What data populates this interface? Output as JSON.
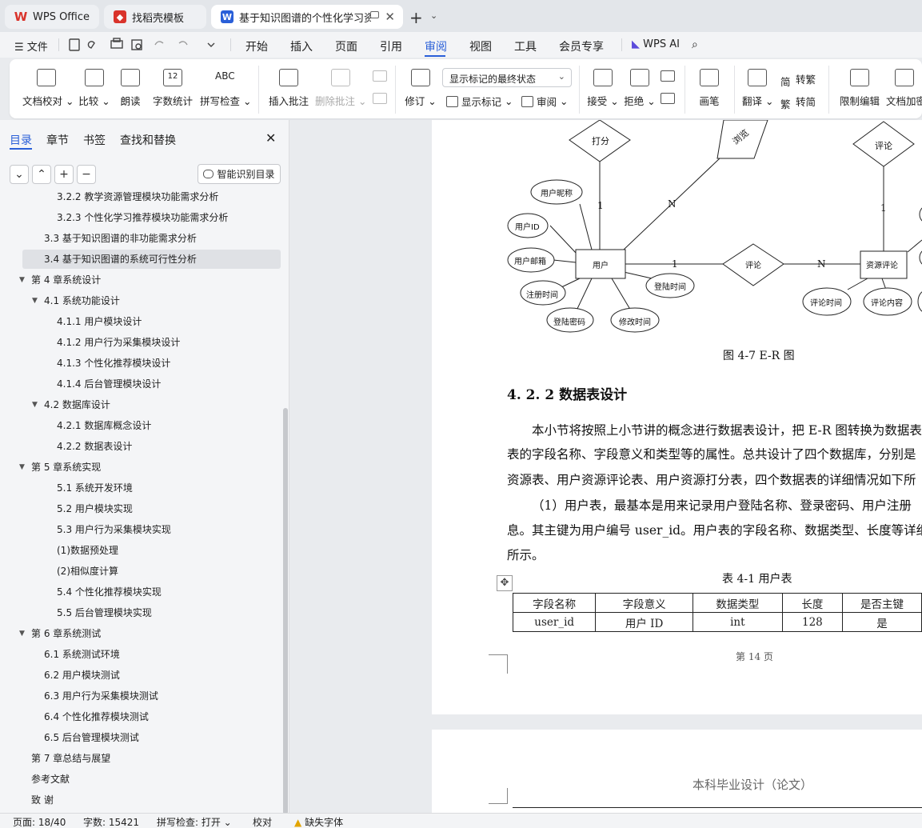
{
  "tabs": [
    {
      "label": "WPS Office"
    },
    {
      "label": "找稻壳模板"
    },
    {
      "label": "基于知识图谱的个性化学习资源推荐系统"
    }
  ],
  "menu": {
    "file": "文件",
    "items": [
      "开始",
      "插入",
      "页面",
      "引用",
      "审阅",
      "视图",
      "工具",
      "会员专享"
    ],
    "active": "审阅",
    "wps_ai": "WPS AI"
  },
  "ribbon": {
    "proof": "文档校对",
    "compare": "比较",
    "read": "朗读",
    "wordcount": "字数统计",
    "spell": "拼写检查",
    "spell_icon_text": "ABC",
    "wordcount_icon_text": "12",
    "insert_comment": "插入批注",
    "delete_comment": "删除批注",
    "revise": "修订",
    "mark_state": "显示标记的最终状态",
    "show_marks": "显示标记",
    "review": "审阅",
    "accept": "接受",
    "reject": "拒绝",
    "pen": "画笔",
    "translate": "翻译",
    "to_trad": "转繁",
    "to_simp": "转简",
    "restrict": "限制编辑",
    "encrypt": "文档加密"
  },
  "nav": {
    "tabs": [
      "目录",
      "章节",
      "书签",
      "查找和替换"
    ],
    "smart_toc": "智能识别目录",
    "toc": [
      {
        "text": "3.2.2 教学资源管理模块功能需求分析",
        "level": 3,
        "arrow": ""
      },
      {
        "text": "3.2.3 个性化学习推荐模块功能需求分析",
        "level": 3,
        "arrow": ""
      },
      {
        "text": "3.3  基于知识图谱的非功能需求分析",
        "level": 2,
        "arrow": ""
      },
      {
        "text": "3.4  基于知识图谱的系统可行性分析",
        "level": 2,
        "arrow": "",
        "selected": true
      },
      {
        "text": "第 4 章系统设计",
        "level": 1,
        "arrow": "▼"
      },
      {
        "text": "4.1  系统功能设计",
        "level": 2,
        "arrow": "▼"
      },
      {
        "text": "4.1.1  用户模块设计",
        "level": 3,
        "arrow": ""
      },
      {
        "text": "4.1.2  用户行为采集模块设计",
        "level": 3,
        "arrow": ""
      },
      {
        "text": "4.1.3  个性化推荐模块设计",
        "level": 3,
        "arrow": ""
      },
      {
        "text": "4.1.4  后台管理模块设计",
        "level": 3,
        "arrow": ""
      },
      {
        "text": "4.2  数据库设计",
        "level": 2,
        "arrow": "▼"
      },
      {
        "text": "4.2.1  数据库概念设计",
        "level": 3,
        "arrow": ""
      },
      {
        "text": "4.2.2  数据表设计",
        "level": 3,
        "arrow": ""
      },
      {
        "text": "第 5 章系统实现",
        "level": 1,
        "arrow": "▼"
      },
      {
        "text": "5.1  系统开发环境",
        "level": 3,
        "arrow": ""
      },
      {
        "text": "5.2  用户模块实现",
        "level": 3,
        "arrow": ""
      },
      {
        "text": "5.3  用户行为采集模块实现",
        "level": 3,
        "arrow": ""
      },
      {
        "text": "(1)数据预处理",
        "level": 3,
        "arrow": ""
      },
      {
        "text": "(2)相似度计算",
        "level": 3,
        "arrow": ""
      },
      {
        "text": "5.4  个性化推荐模块实现",
        "level": 3,
        "arrow": ""
      },
      {
        "text": "5.5  后台管理模块实现",
        "level": 3,
        "arrow": ""
      },
      {
        "text": "第 6 章系统测试",
        "level": 1,
        "arrow": "▼"
      },
      {
        "text": "6.1  系统测试环境",
        "level": 2,
        "arrow": ""
      },
      {
        "text": "6.2  用户模块测试",
        "level": 2,
        "arrow": ""
      },
      {
        "text": "6.3  用户行为采集模块测试",
        "level": 2,
        "arrow": ""
      },
      {
        "text": "6.4  个性化推荐模块测试",
        "level": 2,
        "arrow": ""
      },
      {
        "text": "6.5  后台管理模块测试",
        "level": 2,
        "arrow": ""
      },
      {
        "text": "第 7 章总结与展望",
        "level": 1,
        "arrow": ""
      },
      {
        "text": "参考文献",
        "level": 1,
        "arrow": ""
      },
      {
        "text": "致      谢",
        "level": 1,
        "arrow": ""
      }
    ]
  },
  "er": {
    "score": "打分",
    "browse": "浏览",
    "comment_top": "评论",
    "nickname": "用户昵称",
    "userid": "用户ID",
    "email": "用户邮箱",
    "regtime": "注册时间",
    "password": "登陆密码",
    "modtime": "修改时间",
    "logintime": "登陆时间",
    "user": "用户",
    "comment": "评论",
    "res_comment": "资源评论",
    "comment_time": "评论时间",
    "comment_content": "评论内容",
    "one_a": "1",
    "one_b": "1",
    "one_c": "1",
    "n_a": "N",
    "n_b": "N"
  },
  "doc": {
    "figure_caption": "图 4-7  E-R 图",
    "heading": "4. 2. 2  数据表设计",
    "para1_l1": "本小节将按照上小节讲的概念进行数据表设计，把 E-R 图转换为数据表",
    "para1_l2": "表的字段名称、字段意义和类型等的属性。总共设计了四个数据库，分别是",
    "para1_l3": "资源表、用户资源评论表、用户资源打分表，四个数据表的详细情况如下所",
    "para2_l1": "（1）用户表，最基本是用来记录用户登陆名称、登录密码、用户注册",
    "para2_l2": "息。其主键为用户编号 user_id。用户表的字段名称、数据类型、长度等详细",
    "para2_l3": "所示。",
    "table_caption": "表 4-1  用户表",
    "table_header": [
      "字段名称",
      "字段意义",
      "数据类型",
      "长度",
      "是否主键"
    ],
    "table_rows": [
      [
        "user_id",
        "用户 ID",
        "int",
        "128",
        "是"
      ]
    ],
    "page_number": "第 14 页",
    "page2_header": "本科毕业设计（论文）"
  },
  "status": {
    "page": "页面: 18/40",
    "words": "字数: 15421",
    "spell": "拼写检查: 打开",
    "proof": "校对",
    "missing_font": "缺失字体"
  },
  "colors": {
    "accent": "#2a5fd8",
    "wps_red": "#d9332b"
  }
}
